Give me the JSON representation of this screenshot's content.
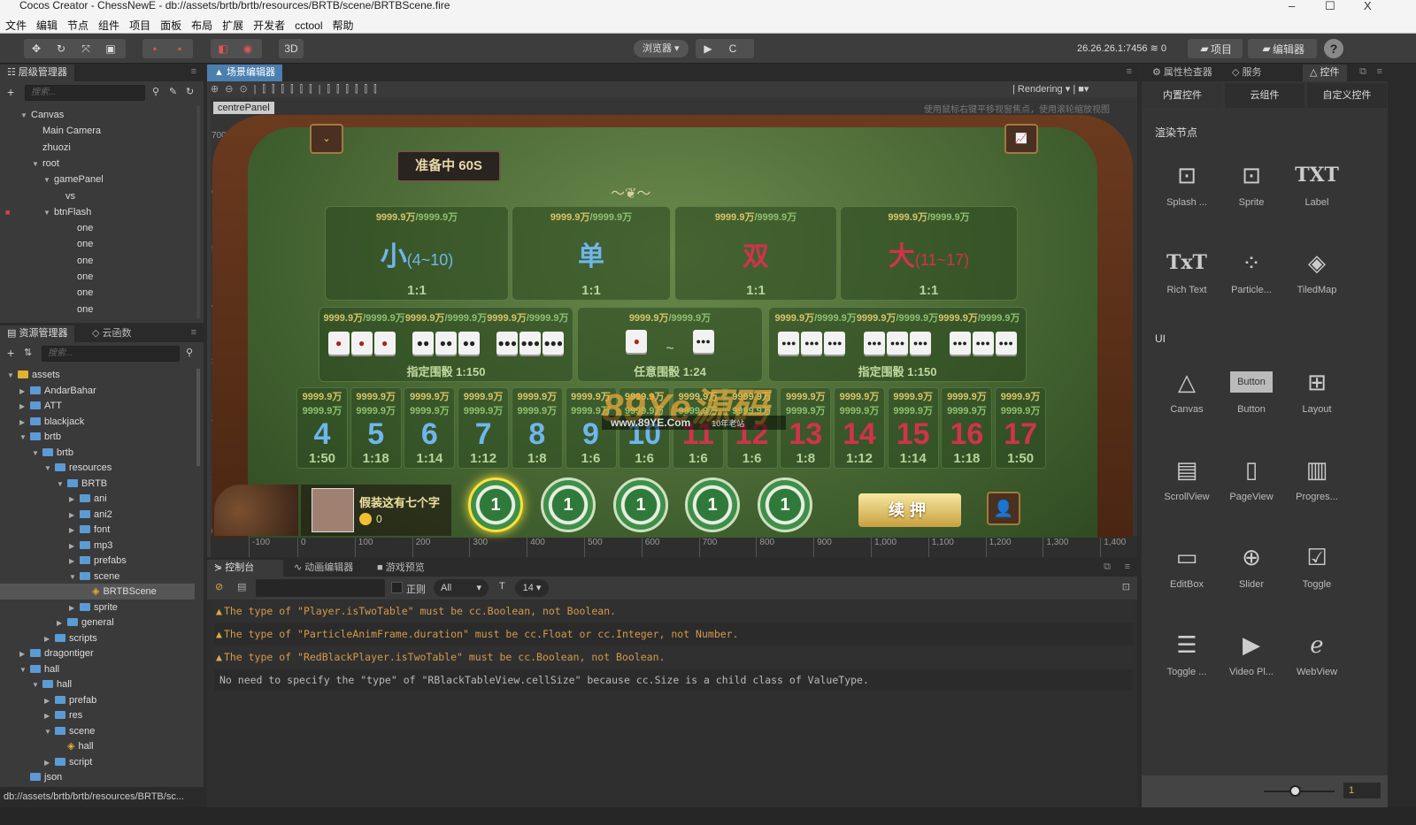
{
  "window": {
    "title": "Cocos Creator - ChessNewE - db://assets/brtb/brtb/resources/BRTB/scene/BRTBScene.fire",
    "controls": [
      "–",
      "☐",
      "X"
    ]
  },
  "menu": [
    "文件",
    "编辑",
    "节点",
    "组件",
    "项目",
    "面板",
    "布局",
    "扩展",
    "开发者",
    "cctool",
    "帮助"
  ],
  "toolbar": {
    "mode_3d": "3D",
    "browser": "浏览器 ▾",
    "play": "▶",
    "refresh": "C",
    "ip": "26.26.26.1:7456",
    "connections": "0",
    "project_btn": "项目",
    "editor_btn": "编辑器",
    "help": "?"
  },
  "hierarchy": {
    "title": "层级管理器",
    "search_placeholder": "搜索...",
    "items": [
      {
        "label": "Canvas",
        "depth": 1,
        "arrow": "▼"
      },
      {
        "label": "Main Camera",
        "depth": 2
      },
      {
        "label": "zhuozi",
        "depth": 2
      },
      {
        "label": "root",
        "depth": 2,
        "arrow": "▼"
      },
      {
        "label": "gamePanel",
        "depth": 3,
        "arrow": "▼"
      },
      {
        "label": "vs",
        "depth": 4
      },
      {
        "label": "btnFlash",
        "depth": 3,
        "arrow": "▼",
        "locked": true
      },
      {
        "label": "one",
        "depth": 5
      },
      {
        "label": "one",
        "depth": 5
      },
      {
        "label": "one",
        "depth": 5
      },
      {
        "label": "one",
        "depth": 5
      },
      {
        "label": "one",
        "depth": 5
      },
      {
        "label": "one",
        "depth": 5
      }
    ]
  },
  "assets": {
    "title": "资源管理器",
    "tab2": "云函数",
    "search_placeholder": "搜索...",
    "items": [
      {
        "label": "assets",
        "depth": 0,
        "arrow": "▼",
        "type": "root"
      },
      {
        "label": "AndarBahar",
        "depth": 1,
        "arrow": "▶"
      },
      {
        "label": "ATT",
        "depth": 1,
        "arrow": "▶"
      },
      {
        "label": "blackjack",
        "depth": 1,
        "arrow": "▶"
      },
      {
        "label": "brtb",
        "depth": 1,
        "arrow": "▼"
      },
      {
        "label": "brtb",
        "depth": 2,
        "arrow": "▼"
      },
      {
        "label": "resources",
        "depth": 3,
        "arrow": "▼"
      },
      {
        "label": "BRTB",
        "depth": 4,
        "arrow": "▼"
      },
      {
        "label": "ani",
        "depth": 5,
        "arrow": "▶"
      },
      {
        "label": "ani2",
        "depth": 5,
        "arrow": "▶"
      },
      {
        "label": "font",
        "depth": 5,
        "arrow": "▶"
      },
      {
        "label": "mp3",
        "depth": 5,
        "arrow": "▶"
      },
      {
        "label": "prefabs",
        "depth": 5,
        "arrow": "▶"
      },
      {
        "label": "scene",
        "depth": 5,
        "arrow": "▼"
      },
      {
        "label": "BRTBScene",
        "depth": 6,
        "type": "scene",
        "selected": true
      },
      {
        "label": "sprite",
        "depth": 5,
        "arrow": "▶"
      },
      {
        "label": "general",
        "depth": 4,
        "arrow": "▶"
      },
      {
        "label": "scripts",
        "depth": 3,
        "arrow": "▶"
      },
      {
        "label": "dragontiger",
        "depth": 1,
        "arrow": "▶"
      },
      {
        "label": "hall",
        "depth": 1,
        "arrow": "▼"
      },
      {
        "label": "hall",
        "depth": 2,
        "arrow": "▼"
      },
      {
        "label": "prefab",
        "depth": 3,
        "arrow": "▶"
      },
      {
        "label": "res",
        "depth": 3,
        "arrow": "▶"
      },
      {
        "label": "scene",
        "depth": 3,
        "arrow": "▼"
      },
      {
        "label": "hall",
        "depth": 4,
        "type": "scene"
      },
      {
        "label": "script",
        "depth": 3,
        "arrow": "▶"
      },
      {
        "label": "json",
        "depth": 1
      }
    ]
  },
  "status_path": "db://assets/brtb/brtb/resources/BRTB/sc...",
  "scene_editor": {
    "tab": "场景编辑器",
    "rendering": "Rendering ▾",
    "node_label": "centrePanel",
    "hint": "使用鼠标右键平移视窗焦点，使用滚轮缩放视图",
    "ruler_x": [
      "-100",
      "0",
      "100",
      "200",
      "300",
      "400",
      "500",
      "600",
      "700",
      "800",
      "900",
      "1,000",
      "1,100",
      "1,200",
      "1,300",
      "1,400"
    ],
    "ruler_y": [
      "700",
      "600",
      "500",
      "400",
      "300",
      "200",
      "100",
      "0"
    ]
  },
  "game": {
    "timer": "准备中 60S",
    "limit": "9999.9万",
    "limit_sep": "/",
    "big_bets": [
      {
        "label": "小",
        "range": "(4~10)",
        "odds": "1:1",
        "color": "#6fb6ec"
      },
      {
        "label": "单",
        "range": "",
        "odds": "1:1",
        "color": "#6fb6ec"
      },
      {
        "label": "双",
        "range": "",
        "odds": "1:1",
        "color": "#d0334a"
      },
      {
        "label": "大",
        "range": "(11~17)",
        "odds": "1:1",
        "color": "#d0334a"
      }
    ],
    "triple_left": "指定围骰 1:150",
    "any_triple": "任意围骰 1:24",
    "triple_right": "指定围骰 1:150",
    "any_sep": "~",
    "numbers": [
      {
        "n": "4",
        "o": "1:50"
      },
      {
        "n": "5",
        "o": "1:18"
      },
      {
        "n": "6",
        "o": "1:14"
      },
      {
        "n": "7",
        "o": "1:12"
      },
      {
        "n": "8",
        "o": "1:8"
      },
      {
        "n": "9",
        "o": "1:6"
      },
      {
        "n": "10",
        "o": "1:6"
      },
      {
        "n": "11",
        "o": "1:6"
      },
      {
        "n": "12",
        "o": "1:6"
      },
      {
        "n": "13",
        "o": "1:8"
      },
      {
        "n": "14",
        "o": "1:12"
      },
      {
        "n": "15",
        "o": "1:14"
      },
      {
        "n": "16",
        "o": "1:18"
      },
      {
        "n": "17",
        "o": "1:50"
      }
    ],
    "low_color": "#6fb6ec",
    "high_color": "#d0334a",
    "player_name": "假装这有七个字",
    "player_coins": "0",
    "chips": [
      "1",
      "1",
      "1",
      "1",
      "1"
    ],
    "selected_chip": 0,
    "rebet": "续押",
    "watermark": {
      "logo": "89Ye源码",
      "url": "www.89YE.Com",
      "tag": "10年老站"
    }
  },
  "console": {
    "tabs": [
      "控制台",
      "动画编辑器",
      "游戏预览"
    ],
    "regex": "正则",
    "level": "All",
    "font_size": "14 ▾",
    "logs": [
      {
        "type": "warn",
        "text": "The type of \"Player.isTwoTable\" must be cc.Boolean, not Boolean."
      },
      {
        "type": "warn",
        "text": "The type of \"ParticleAnimFrame.duration\" must be cc.Float or cc.Integer, not Number."
      },
      {
        "type": "warn",
        "text": "The type of \"RedBlackPlayer.isTwoTable\" must be cc.Boolean, not Boolean."
      },
      {
        "type": "info",
        "text": "No need to specify the \"type\" of \"RBlackTableView.cellSize\" because cc.Size is a child class of ValueType."
      }
    ]
  },
  "right_panel": {
    "tabs": [
      "属性检查器",
      "服务",
      "控件"
    ],
    "subtabs": [
      "内置控件",
      "云组件",
      "自定义控件"
    ],
    "render_title": "渲染节点",
    "ui_title": "UI",
    "render_nodes": [
      {
        "label": "Splash ...",
        "icon": "⊡"
      },
      {
        "label": "Sprite",
        "icon": "⊡"
      },
      {
        "label": "Label",
        "icon": "TXT"
      },
      {
        "label": "Rich Text",
        "icon": "TxT"
      },
      {
        "label": "Particle...",
        "icon": "⁘"
      },
      {
        "label": "TiledMap",
        "icon": "◈"
      }
    ],
    "ui_nodes": [
      {
        "label": "Canvas",
        "icon": "△"
      },
      {
        "label": "Button",
        "icon": "Button"
      },
      {
        "label": "Layout",
        "icon": "⊞"
      },
      {
        "label": "ScrollView",
        "icon": "▤"
      },
      {
        "label": "PageView",
        "icon": "▯"
      },
      {
        "label": "Progres...",
        "icon": "▥"
      },
      {
        "label": "EditBox",
        "icon": "▭"
      },
      {
        "label": "Slider",
        "icon": "⊕"
      },
      {
        "label": "Toggle",
        "icon": "☑"
      },
      {
        "label": "Toggle ...",
        "icon": "☰"
      },
      {
        "label": "Video Pl...",
        "icon": "▶"
      },
      {
        "label": "WebView",
        "icon": "ℯ"
      }
    ],
    "zoom_value": "1"
  }
}
